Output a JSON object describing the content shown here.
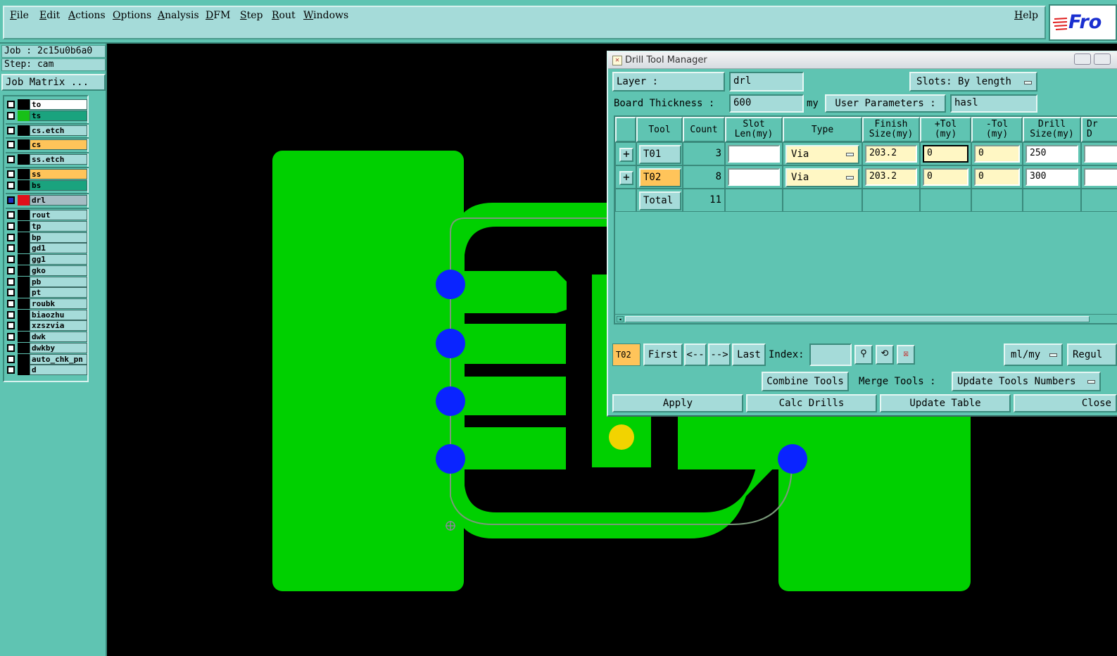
{
  "menu": {
    "items": [
      "File",
      "Edit",
      "Actions",
      "Options",
      "Analysis",
      "DFM",
      "Step",
      "Rout",
      "Windows"
    ],
    "help": "Help",
    "logo_text": "Fro"
  },
  "left": {
    "job": "Job : 2c15u0b6a0",
    "step": "Step: cam",
    "job_matrix": "Job Matrix ...",
    "layers": [
      {
        "name": "to",
        "color": "#000000",
        "label_bg": "#ffffff"
      },
      {
        "name": "ts",
        "color": "#18c018",
        "label_bg": "#1aa37e"
      },
      {
        "name": "cs.etch",
        "color": "#000000",
        "label_bg": "#a5dbd9"
      },
      {
        "name": "cs",
        "color": "#000000",
        "label_bg": "#ffc45a"
      },
      {
        "name": "ss.etch",
        "color": "#000000",
        "label_bg": "#a5dbd9"
      },
      {
        "name": "ss",
        "color": "#000000",
        "label_bg": "#ffc45a"
      },
      {
        "name": "bs",
        "color": "#000000",
        "label_bg": "#1aa37e"
      },
      {
        "name": "drl",
        "color": "#e0101a",
        "label_bg": "#a5bdc4"
      },
      {
        "name": "rout",
        "color": "#000000",
        "label_bg": "#a5dbd9"
      },
      {
        "name": "tp",
        "color": "#000000",
        "label_bg": "#a5dbd9"
      },
      {
        "name": "bp",
        "color": "#000000",
        "label_bg": "#a5dbd9"
      },
      {
        "name": "gd1",
        "color": "#000000",
        "label_bg": "#a5dbd9"
      },
      {
        "name": "gg1",
        "color": "#000000",
        "label_bg": "#a5dbd9"
      },
      {
        "name": "gko",
        "color": "#000000",
        "label_bg": "#a5dbd9"
      },
      {
        "name": "pb",
        "color": "#000000",
        "label_bg": "#a5dbd9"
      },
      {
        "name": "pt",
        "color": "#000000",
        "label_bg": "#a5dbd9"
      },
      {
        "name": "roubk",
        "color": "#000000",
        "label_bg": "#a5dbd9"
      },
      {
        "name": "biaozhu",
        "color": "#000000",
        "label_bg": "#a5dbd9"
      },
      {
        "name": "xzszvia",
        "color": "#000000",
        "label_bg": "#a5dbd9"
      },
      {
        "name": "dwk",
        "color": "#000000",
        "label_bg": "#a5dbd9"
      },
      {
        "name": "dwkby",
        "color": "#000000",
        "label_bg": "#a5dbd9"
      },
      {
        "name": "auto_chk_pn",
        "color": "#000000",
        "label_bg": "#a5dbd9"
      },
      {
        "name": "d",
        "color": "#000000",
        "label_bg": "#a5dbd9"
      }
    ]
  },
  "dialog": {
    "title": "Drill Tool Manager",
    "layer_label": "Layer           :",
    "layer_value": "drl",
    "slots_label": "Slots:",
    "slots_value": "By length",
    "board_thickness_label": "Board Thickness :",
    "board_thickness_value": "600",
    "board_thickness_unit": "my",
    "user_params_label": "User Parameters :",
    "user_params_value": "hasl",
    "headers": [
      "Tool",
      "Count",
      "Slot\nLen(my)",
      "Type",
      "Finish\nSize(my)",
      "+Tol\n(my)",
      "-Tol\n(my)",
      "Drill\nSize(my)",
      "Dr\nD"
    ],
    "rows": [
      {
        "tool": "T01",
        "count": "3",
        "slot_len": "",
        "type": "Via",
        "finish": "203.2",
        "plus_tol": "0",
        "minus_tol": "0",
        "drill": "250"
      },
      {
        "tool": "T02",
        "count": "8",
        "slot_len": "",
        "type": "Via",
        "finish": "203.2",
        "plus_tol": "0",
        "minus_tol": "0",
        "drill": "300"
      }
    ],
    "total_label": "Total",
    "total_count": "11",
    "current_tool": "T02",
    "nav": {
      "first": "First",
      "prev": "<--",
      "next": "-->",
      "last": "Last",
      "index_label": "Index:",
      "index_value": "",
      "units": "ml/my",
      "regul": "Regul"
    },
    "combine_tools": "Combine Tools",
    "merge_tools_label": "Merge Tools :",
    "merge_tools_value": "Update Tools Numbers",
    "apply": "Apply",
    "calc_drills": "Calc Drills",
    "update_table": "Update Table",
    "close": "Close"
  },
  "colors": {
    "panel": "#5fc4b2",
    "button": "#a5dbd9",
    "copper": "#00d000",
    "drill_pad": "#0a24ff",
    "yellow_pad": "#f2d300"
  }
}
